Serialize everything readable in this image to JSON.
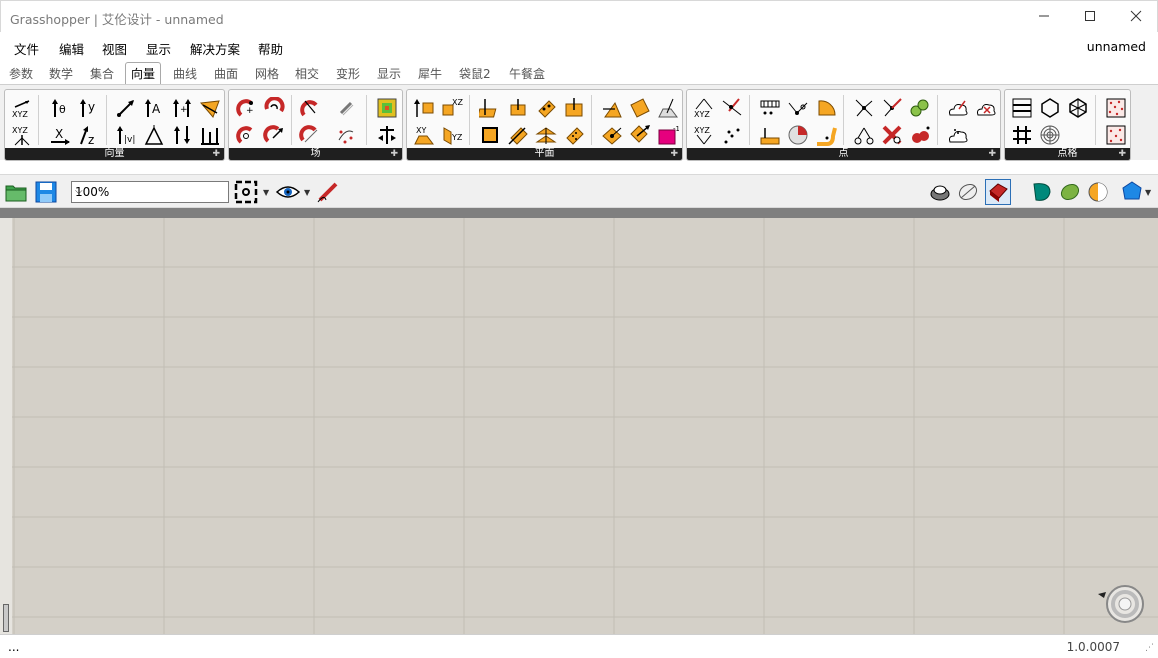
{
  "window": {
    "title": "Grasshopper | 艾伦设计 - unnamed",
    "minimize_icon": "minimize-icon",
    "maximize_icon": "maximize-icon",
    "close_icon": "close-icon"
  },
  "menu": {
    "items": [
      "文件",
      "编辑",
      "视图",
      "显示",
      "解决方案",
      "帮助"
    ],
    "document_name": "unnamed"
  },
  "tabs": {
    "items": [
      "参数",
      "数学",
      "集合",
      "向量",
      "曲线",
      "曲面",
      "网格",
      "相交",
      "变形",
      "显示",
      "犀牛",
      "袋鼠2",
      "午餐盒"
    ],
    "active": "向量"
  },
  "ribbon": {
    "groups": [
      {
        "label": "向量",
        "icon_count": 16
      },
      {
        "label": "场",
        "icon_count": 8
      },
      {
        "label": "平面",
        "icon_count": 18
      },
      {
        "label": "点",
        "icon_count": 18
      },
      {
        "label": "点格",
        "icon_count": 7
      }
    ],
    "accent_colors": {
      "orange": "#f5a623",
      "red": "#c62828",
      "magenta": "#e6007e",
      "green": "#8bc34a"
    }
  },
  "toolbar": {
    "zoom_value": "100%"
  },
  "statusbar": {
    "left_text": "...",
    "version": "1.0.0007"
  }
}
